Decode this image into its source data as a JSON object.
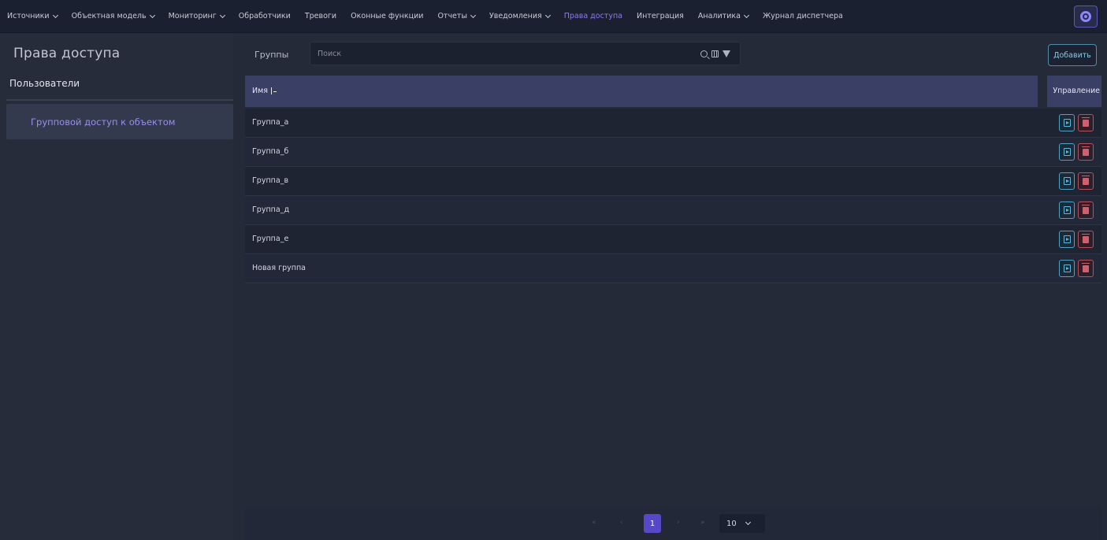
{
  "nav": {
    "items": [
      {
        "label": "Источники",
        "dropdown": true
      },
      {
        "label": "Объектная модель",
        "dropdown": true
      },
      {
        "label": "Мониторинг",
        "dropdown": true
      },
      {
        "label": "Обработчики",
        "dropdown": false
      },
      {
        "label": "Тревоги",
        "dropdown": false
      },
      {
        "label": "Оконные функции",
        "dropdown": false
      },
      {
        "label": "Отчеты",
        "dropdown": true
      },
      {
        "label": "Уведомления",
        "dropdown": true
      },
      {
        "label": "Права доступа",
        "dropdown": false,
        "active": true
      },
      {
        "label": "Интеграция",
        "dropdown": false
      },
      {
        "label": "Аналитика",
        "dropdown": true
      },
      {
        "label": "Журнал диспетчера",
        "dropdown": false
      }
    ],
    "settings_icon": "gear-icon"
  },
  "sidebar": {
    "title": "Права доступа",
    "users_label": "Пользователи",
    "group_access_label": "Групповой доступ к объектом"
  },
  "main": {
    "groups_label": "Группы",
    "search_placeholder": "Поиск",
    "add_label": "Добавить"
  },
  "table": {
    "col_name": "Имя",
    "col_manage": "Управление",
    "rows": [
      "Группа_а",
      "Группа_б",
      "Группа_в",
      "Группа_д",
      "Группа_е",
      "Новая группа"
    ]
  },
  "pagination": {
    "current_page": "1",
    "page_size": "10"
  },
  "colors": {
    "accent": "#8b7cf0",
    "current_page_bg": "#5648c6",
    "open_button": "#4fa1c4",
    "delete_button": "#b5525e"
  }
}
